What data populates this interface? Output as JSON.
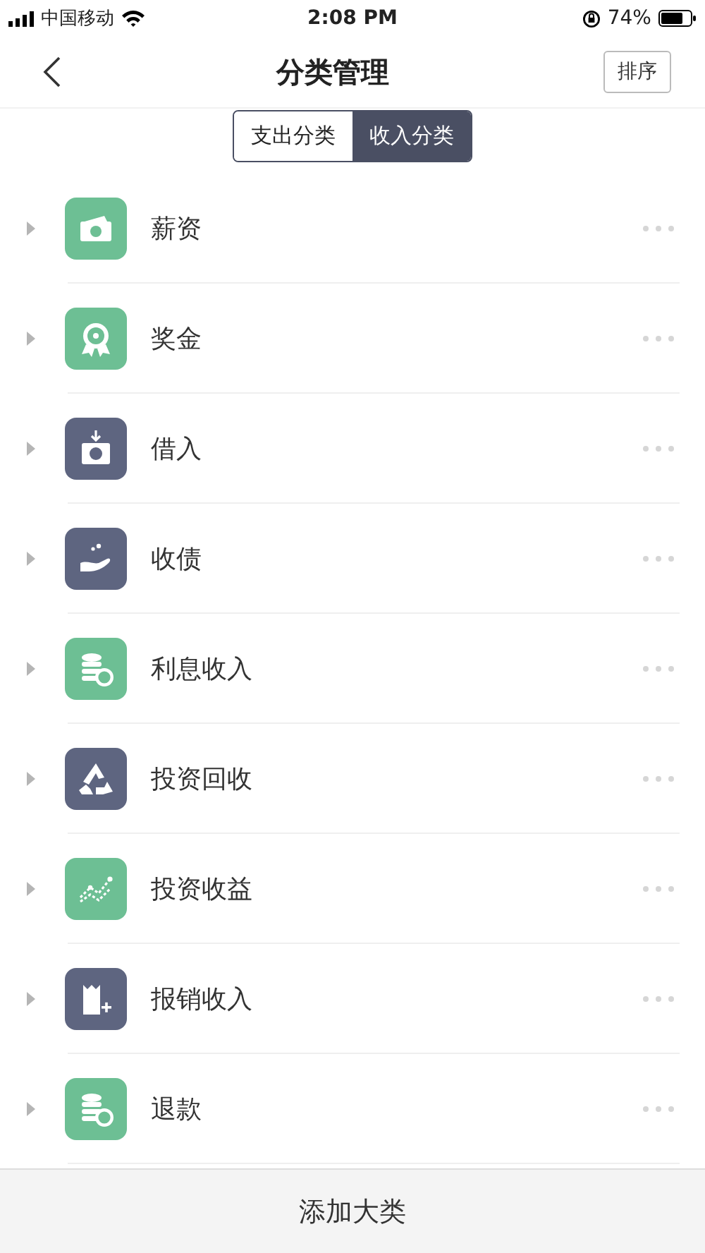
{
  "status_bar": {
    "carrier": "中国移动",
    "time": "2:08 PM",
    "battery": "74%"
  },
  "nav": {
    "title": "分类管理",
    "sort_button": "排序"
  },
  "tabs": [
    {
      "label": "支出分类",
      "selected": false
    },
    {
      "label": "收入分类",
      "selected": true
    }
  ],
  "categories": [
    {
      "name": "薪资",
      "kind": "wallet",
      "color": "#6dbf94"
    },
    {
      "name": "奖金",
      "kind": "medal",
      "color": "#6dbf94"
    },
    {
      "name": "借入",
      "kind": "box",
      "color": "#5e6580"
    },
    {
      "name": "收债",
      "kind": "hand",
      "color": "#5e6580"
    },
    {
      "name": "利息收入",
      "kind": "coins",
      "color": "#6dbf94"
    },
    {
      "name": "投资回收",
      "kind": "recycle",
      "color": "#5e6580"
    },
    {
      "name": "投资收益",
      "kind": "chart",
      "color": "#6dbf94"
    },
    {
      "name": "报销收入",
      "kind": "receipt",
      "color": "#5e6580"
    },
    {
      "name": "退款",
      "kind": "refund",
      "color": "#6dbf94"
    }
  ],
  "add_button": "添加大类"
}
